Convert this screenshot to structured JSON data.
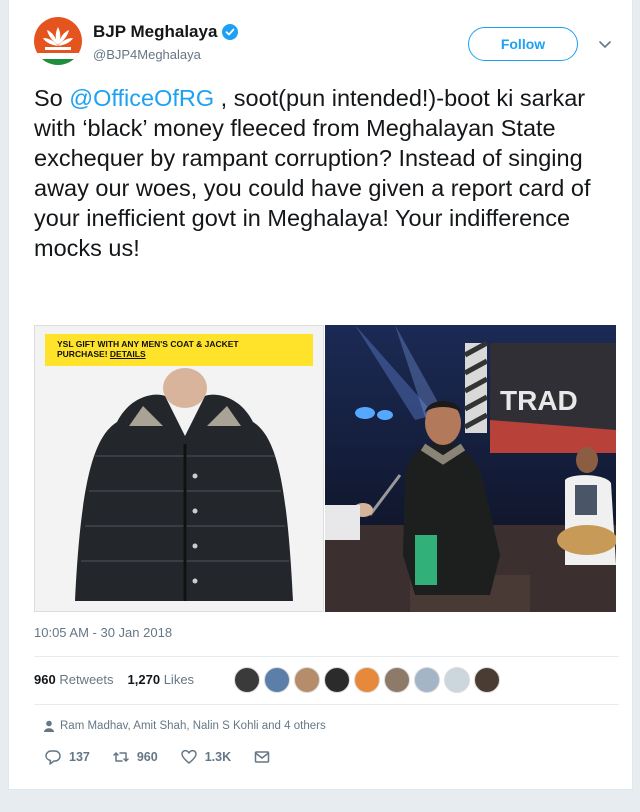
{
  "tweet": {
    "display_name": "BJP Meghalaya",
    "handle": "@BJP4Meghalaya",
    "follow_label": "Follow",
    "text_before": "So ",
    "mention": "@OfficeOfRG",
    "text_after": " , soot(pun intended!)-boot ki sarkar with ‘black’ money fleeced from Meghalayan State exchequer by rampant corruption? Instead of singing away our woes, you could have given a report card of your inefficient govt in Meghalaya! Your indifference mocks us!",
    "image_left_banner_line1": "YSL GIFT WITH ANY MEN'S COAT & JACKET",
    "image_left_banner_line2": "PURCHASE!",
    "image_left_banner_link": "DETAILS",
    "image_right_sign": "TRAD",
    "timestamp": "10:05 AM - 30 Jan 2018",
    "retweets_count": "960",
    "retweets_label": "Retweets",
    "likes_count": "1,270",
    "likes_label": "Likes",
    "liked_by": "Ram Madhav, Amit Shah, Nalin S Kohli and 4 others",
    "reply_count": "137",
    "retweet_count": "960",
    "like_count": "1.3K"
  },
  "colors": {
    "accent": "#1da1f2",
    "muted": "#657786",
    "avatar_bg": "#e5541e",
    "banner_yellow": "#ffe32a"
  },
  "icons": [
    "verified-icon",
    "chevron-down-icon",
    "user-icon",
    "reply-icon",
    "retweet-icon",
    "heart-icon",
    "mail-icon"
  ]
}
